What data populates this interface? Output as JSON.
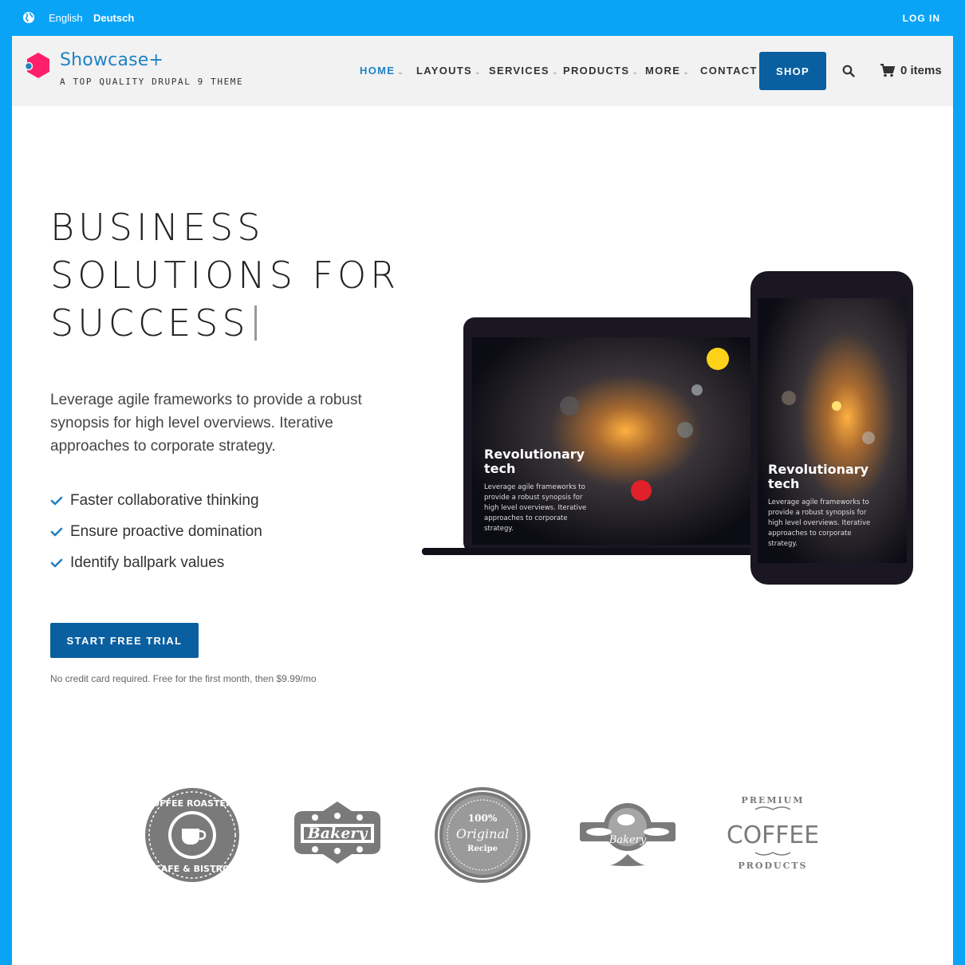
{
  "topbar": {
    "language_en": "English",
    "language_de": "Deutsch",
    "login": "LOG IN"
  },
  "branding": {
    "site_name": "Showcase+",
    "slogan": "A TOP QUALITY DRUPAL 9 THEME",
    "logo_colors": [
      "#ff1f6a",
      "#1e82c2"
    ]
  },
  "nav": {
    "items": [
      {
        "label": "HOME",
        "dropdown": true,
        "active": true
      },
      {
        "label": "LAYOUTS",
        "dropdown": true
      },
      {
        "label": "SERVICES",
        "dropdown": true
      },
      {
        "label": "PRODUCTS",
        "dropdown": true
      },
      {
        "label": "MORE",
        "dropdown": true
      },
      {
        "label": "CONTACT",
        "dropdown": false
      }
    ],
    "shop_label": "SHOP",
    "cart_label": "0 items"
  },
  "hero": {
    "title_lines": [
      "BUSINESS",
      "SOLUTIONS FOR",
      "SUCCESS"
    ],
    "description": "Leverage agile frameworks to provide a robust synopsis for high level overviews. Iterative approaches to corporate strategy.",
    "checklist": [
      "Faster collaborative thinking",
      "Ensure proactive domination",
      "Identify ballpark values"
    ],
    "cta_label": "START FREE TRIAL",
    "cta_note": "No credit card required. Free for the first month, then $9.99/mo"
  },
  "devices": {
    "laptop_heading_line1": "Revolutionary",
    "laptop_heading_line2": "tech",
    "laptop_text": [
      "Leverage agile frameworks to",
      "provide a robust synopsis for",
      "high level overviews. Iterative",
      "approaches to corporate",
      "strategy."
    ],
    "phone_heading_line1": "Revolutionary",
    "phone_heading_line2": "tech",
    "phone_text": [
      "Leverage agile frameworks to",
      "provide a robust synopsis for",
      "high level overviews. Iterative",
      "approaches to corporate",
      "strategy."
    ]
  },
  "client_logos": {
    "coffee_roasters": {
      "top": "COFFEE ROASTERS",
      "bottom": "CAFE & BISTRO"
    },
    "bakery1": "Bakery",
    "original_recipe": {
      "line1": "100%",
      "line2": "Original",
      "line3": "Recipe"
    },
    "bakery2": "Bakery",
    "premium_coffee": {
      "top": "PREMIUM",
      "middle": "COFFEE",
      "bottom": "PRODUCTS"
    }
  },
  "colors": {
    "border": "#0aa4f7",
    "accent": "#1e82c2",
    "button": "#0a5fa0",
    "header_bg": "#f2f2f2"
  }
}
